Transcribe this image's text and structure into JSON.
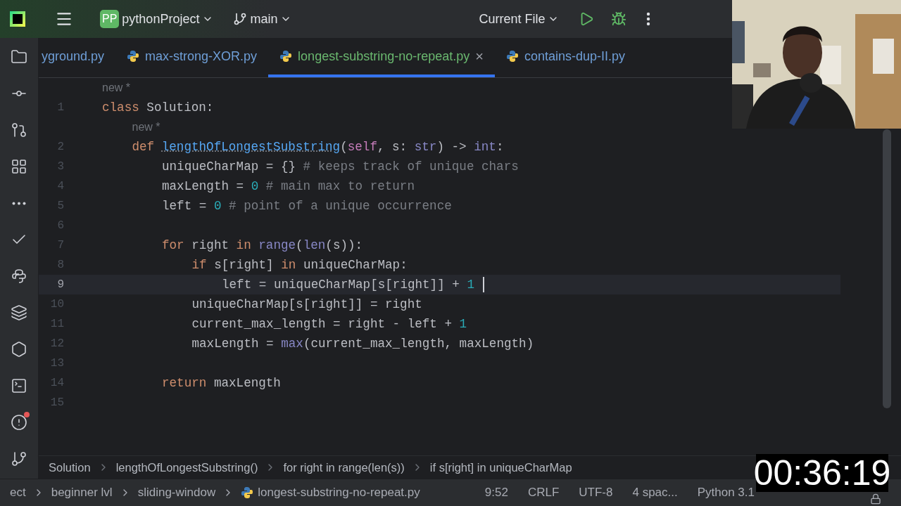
{
  "toolbar": {
    "project_badge": "PP",
    "project": "pythonProject",
    "branch": "main",
    "run_config": "Current File"
  },
  "tabs": [
    {
      "label": "yground.py",
      "selected": false,
      "closable": false
    },
    {
      "label": "max-strong-XOR.py",
      "selected": false,
      "closable": false
    },
    {
      "label": "longest-substring-no-repeat.py",
      "selected": true,
      "closable": true
    },
    {
      "label": "contains-dup-II.py",
      "selected": false,
      "closable": false
    }
  ],
  "close_glyph": "×",
  "editor": {
    "lines": [
      {
        "kind": "hint",
        "text": "new *"
      },
      {
        "kind": "code",
        "number": "1",
        "current": false,
        "tokens": [
          {
            "kind": "kw",
            "s": "class "
          },
          {
            "kind": "plain",
            "s": "Solution:"
          }
        ],
        "children": [
          {
            "kind": "hint",
            "text": "new *"
          },
          {
            "kind": "code",
            "number": "2",
            "current": false,
            "tokens": [
              {
                "kind": "kw",
                "s": "def "
              },
              {
                "kind": "fn",
                "s": "lengthOfLongestSubstring"
              },
              {
                "kind": "plain",
                "s": "("
              },
              {
                "kind": "self",
                "s": "self"
              },
              {
                "kind": "plain",
                "s": ", s: "
              },
              {
                "kind": "builtin",
                "s": "str"
              },
              {
                "kind": "plain",
                "s": ") -> "
              },
              {
                "kind": "builtin",
                "s": "int"
              },
              {
                "kind": "plain",
                "s": ":"
              }
            ],
            "children": [
              {
                "kind": "code",
                "number": "3",
                "current": false,
                "tokens": [
                  {
                    "kind": "plain",
                    "s": "uniqueCharMap = {}"
                  },
                  {
                    "kind": "comment",
                    "s": " # keeps track of unique chars"
                  }
                ]
              },
              {
                "kind": "code",
                "number": "4",
                "current": false,
                "tokens": [
                  {
                    "kind": "plain",
                    "s": "maxLength = "
                  },
                  {
                    "kind": "num",
                    "s": "0"
                  },
                  {
                    "kind": "comment",
                    "s": " # main max to return"
                  }
                ]
              },
              {
                "kind": "code",
                "number": "5",
                "current": false,
                "tokens": [
                  {
                    "kind": "plain",
                    "s": "left = "
                  },
                  {
                    "kind": "num",
                    "s": "0"
                  },
                  {
                    "kind": "comment",
                    "s": " # point of a unique occurrence"
                  }
                ]
              },
              {
                "kind": "code",
                "number": "6",
                "current": false
              },
              {
                "kind": "code",
                "number": "7",
                "current": false,
                "tokens": [
                  {
                    "kind": "kw",
                    "s": "for "
                  },
                  {
                    "kind": "plain",
                    "s": "right "
                  },
                  {
                    "kind": "kw",
                    "s": "in "
                  },
                  {
                    "kind": "builtin",
                    "s": "range"
                  },
                  {
                    "kind": "plain",
                    "s": "("
                  },
                  {
                    "kind": "builtin",
                    "s": "len"
                  },
                  {
                    "kind": "plain",
                    "s": "(s)):"
                  }
                ],
                "children": [
                  {
                    "kind": "code",
                    "number": "8",
                    "current": false,
                    "tokens": [
                      {
                        "kind": "kw",
                        "s": "if "
                      },
                      {
                        "kind": "plain",
                        "s": "s[right] "
                      },
                      {
                        "kind": "kw",
                        "s": "in "
                      },
                      {
                        "kind": "plain",
                        "s": "uniqueCharMap:"
                      }
                    ],
                    "children": [
                      {
                        "kind": "code",
                        "number": "9",
                        "current": true,
                        "tokens": [
                          {
                            "kind": "plain",
                            "s": "left = uniqueCharMap[s[right]] + "
                          },
                          {
                            "kind": "num",
                            "s": "1"
                          }
                        ]
                      }
                    ]
                  },
                  {
                    "kind": "code",
                    "number": "10",
                    "current": false,
                    "tokens": [
                      {
                        "kind": "plain",
                        "s": "uniqueCharMap[s[right]] = right"
                      }
                    ]
                  },
                  {
                    "kind": "code",
                    "number": "11",
                    "current": false,
                    "tokens": [
                      {
                        "kind": "plain",
                        "s": "current_max_length = right - left + "
                      },
                      {
                        "kind": "num",
                        "s": "1"
                      }
                    ]
                  },
                  {
                    "kind": "code",
                    "number": "12",
                    "current": false,
                    "tokens": [
                      {
                        "kind": "plain",
                        "s": "maxLength = "
                      },
                      {
                        "kind": "builtin",
                        "s": "max"
                      },
                      {
                        "kind": "plain",
                        "s": "(current_max_length, maxLength)"
                      }
                    ]
                  }
                ]
              },
              {
                "kind": "code",
                "number": "13",
                "current": false
              },
              {
                "kind": "code",
                "number": "14",
                "current": false,
                "tokens": [
                  {
                    "kind": "kw",
                    "s": "return "
                  },
                  {
                    "kind": "plain",
                    "s": "maxLength"
                  }
                ]
              },
              {
                "kind": "code",
                "number": "15",
                "current": false
              }
            ]
          }
        ]
      }
    ]
  },
  "breadcrumbs": [
    "Solution",
    "lengthOfLongestSubstring()",
    "for right in range(len(s))",
    "if s[right] in uniqueCharMap"
  ],
  "status_bar": {
    "path": [
      {
        "label": "ect",
        "python": false
      },
      {
        "label": "beginner lvl",
        "python": false
      },
      {
        "label": "sliding-window",
        "python": false
      },
      {
        "label": "longest-substring-no-repeat.py",
        "python": true
      }
    ],
    "items": [
      "9:52",
      "CRLF",
      "UTF-8",
      "4 spac...",
      "Python 3.1"
    ]
  },
  "webcam": {
    "kind": "picture"
  },
  "timer": "00:36:19"
}
